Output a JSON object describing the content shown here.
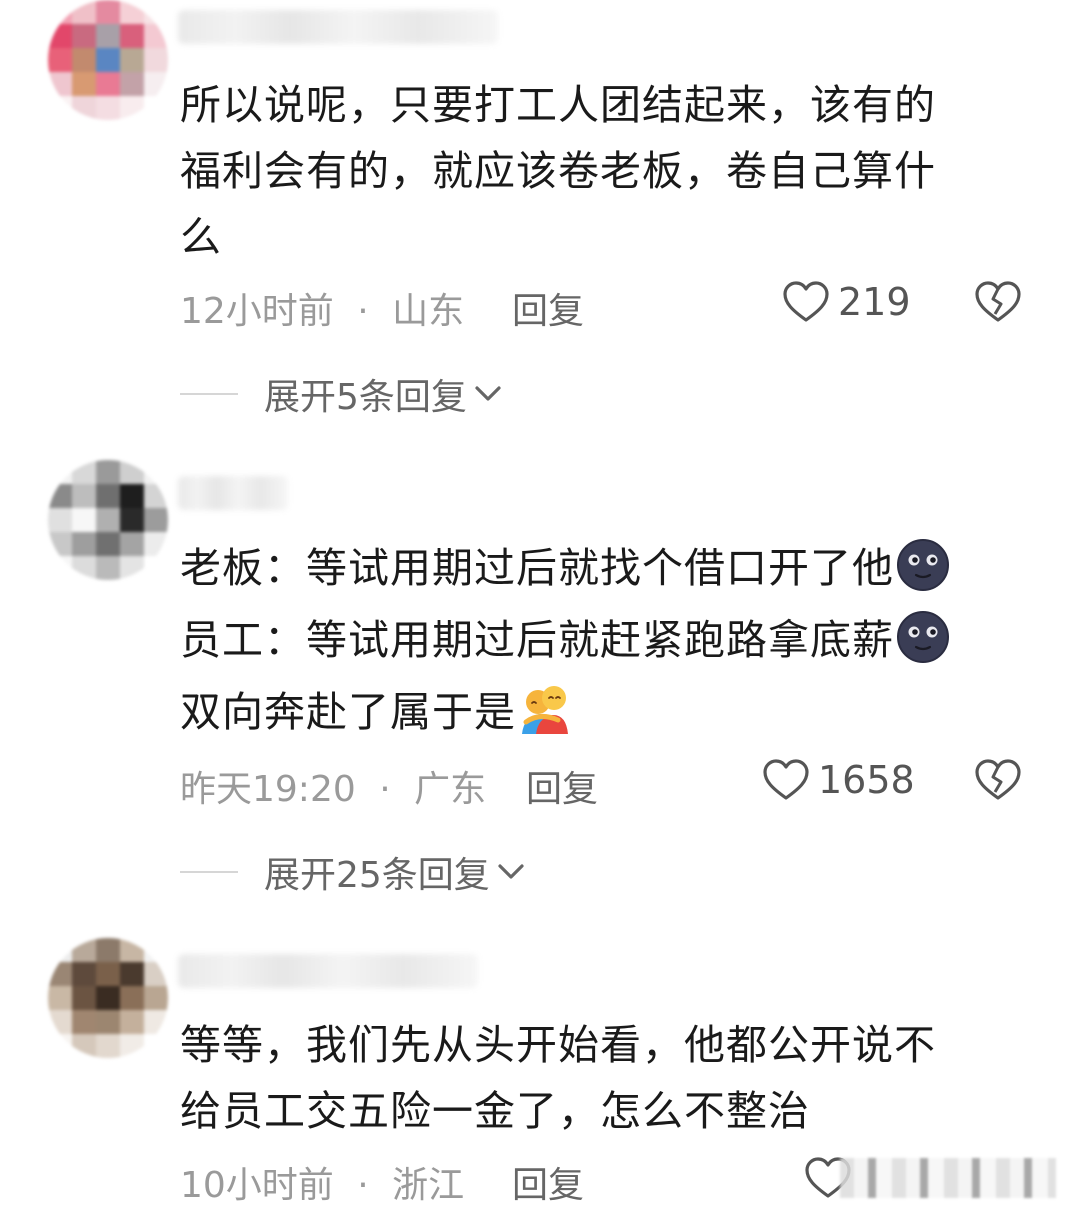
{
  "comments": [
    {
      "lines": [
        "所以说呢，只要打工人团结起来，该有的",
        "福利会有的，就应该卷老板，卷自己算什",
        "么"
      ],
      "time": "12小时前",
      "separator": "·",
      "location": "山东",
      "reply_label": "回复",
      "like_count": "219",
      "expand_label": "展开5条回复"
    },
    {
      "lines": [
        "老板：等试用期过后就找个借口开了他",
        "员工：等试用期过后就赶紧跑路拿底薪",
        "双向奔赴了属于是"
      ],
      "time": "昨天19:20",
      "separator": "·",
      "location": "广东",
      "reply_label": "回复",
      "like_count": "1658",
      "expand_label": "展开25条回复"
    },
    {
      "lines": [
        "等等，我们先从头开始看，他都公开说不",
        "给员工交五险一金了，怎么不整治"
      ],
      "time": "10小时前",
      "separator": "·",
      "location": "浙江",
      "reply_label": "回复"
    }
  ],
  "icons": {
    "like": "heart-outline-icon",
    "dislike": "broken-heart-icon",
    "expand": "chevron-down-icon",
    "emoji_moon": "new-moon-face-emoji",
    "emoji_hug": "people-hugging-emoji"
  },
  "colors": {
    "text": "#1a1a1a",
    "meta": "#9a9a9a",
    "action": "#666666",
    "background": "#ffffff"
  }
}
